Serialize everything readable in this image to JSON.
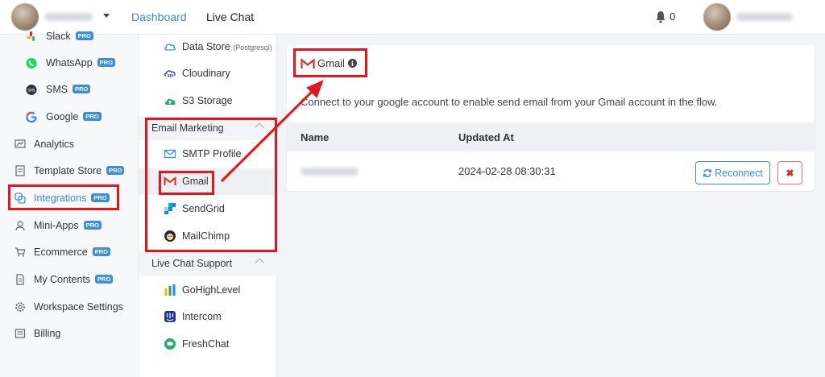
{
  "topbar": {
    "nav": [
      {
        "label": "Dashboard",
        "active": true
      },
      {
        "label": "Live Chat",
        "active": false
      }
    ],
    "notification_count": "0"
  },
  "sidebar": {
    "items": [
      {
        "label": "Slack",
        "pro": "PRO",
        "icon": "slack-icon"
      },
      {
        "label": "WhatsApp",
        "pro": "PRO",
        "icon": "whatsapp-icon"
      },
      {
        "label": "SMS",
        "pro": "PRO",
        "icon": "sms-icon"
      },
      {
        "label": "Google",
        "pro": "PRO",
        "icon": "google-icon"
      },
      {
        "label": "Analytics",
        "pro": "",
        "icon": "analytics-icon"
      },
      {
        "label": "Template Store",
        "pro": "PRO",
        "icon": "template-store-icon"
      },
      {
        "label": "Integrations",
        "pro": "PRO",
        "icon": "integrations-icon",
        "active": true
      },
      {
        "label": "Mini-Apps",
        "pro": "PRO",
        "icon": "mini-apps-icon"
      },
      {
        "label": "Ecommerce",
        "pro": "PRO",
        "icon": "cart-icon"
      },
      {
        "label": "My Contents",
        "pro": "PRO",
        "icon": "contents-icon"
      },
      {
        "label": "Workspace Settings",
        "pro": "",
        "icon": "gear-icon"
      },
      {
        "label": "Billing",
        "pro": "",
        "icon": "billing-icon"
      }
    ]
  },
  "integrations": {
    "storage": [
      {
        "label": "Data Store",
        "sub": "(Postgresql)"
      },
      {
        "label": "Cloudinary",
        "sub": ""
      },
      {
        "label": "S3 Storage",
        "sub": ""
      }
    ],
    "email_marketing": {
      "heading": "Email Marketing",
      "items": [
        "SMTP Profile",
        "Gmail",
        "SendGrid",
        "MailChimp"
      ]
    },
    "live_chat_support": {
      "heading": "Live Chat Support",
      "items": [
        "GoHighLevel",
        "Intercom",
        "FreshChat"
      ]
    }
  },
  "panel": {
    "title": "Gmail",
    "description": "Connect to your google account to enable send email from your Gmail account in the flow.",
    "columns": [
      "Name",
      "Updated At"
    ],
    "rows": [
      {
        "updated_at": "2024-02-28 08:30:31"
      }
    ],
    "reconnect_label": "Reconnect",
    "delete_label": "✖"
  },
  "colors": {
    "accent": "#3c8dde",
    "annotation_red": "#e8141b",
    "pro_badge": "#3c8dde"
  }
}
